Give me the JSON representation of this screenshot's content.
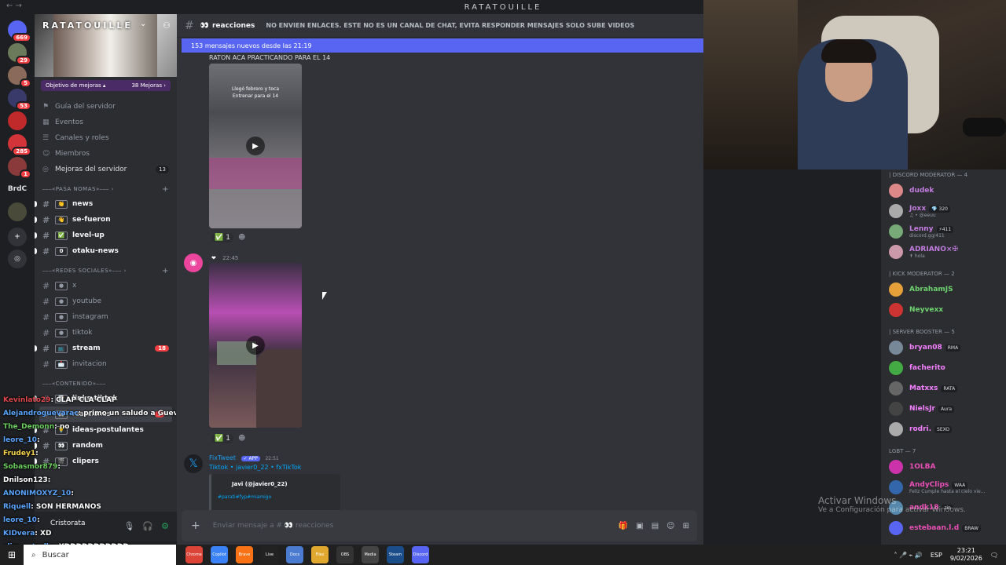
{
  "window": {
    "title": "RATATOUILLE",
    "nav": "← →"
  },
  "rail": {
    "items": [
      {
        "name": "discord-home-icon",
        "badge": "669",
        "color": "#5865f2",
        "label": ""
      },
      {
        "name": "server-1",
        "badge": "29",
        "color": "#6b7a5a",
        "label": ""
      },
      {
        "name": "server-2",
        "badge": "5",
        "color": "#8a6a5a",
        "label": ""
      },
      {
        "name": "server-3",
        "badge": "53",
        "color": "#3a3a6a",
        "label": ""
      },
      {
        "name": "server-4",
        "badge": "",
        "color": "#c02a2a",
        "label": ""
      },
      {
        "name": "server-5",
        "badge": "285",
        "color": "#d3343a",
        "label": ""
      },
      {
        "name": "server-6",
        "badge": "1",
        "color": "#8a3a3a",
        "label": ""
      },
      {
        "name": "server-brdc",
        "badge": "",
        "color": "transparent",
        "label": "BrdC"
      },
      {
        "name": "server-7",
        "badge": "",
        "color": "#4a4a3a",
        "label": ""
      }
    ]
  },
  "sidebar": {
    "server_name": "RATATOUILLE",
    "chevron": "⌄",
    "boost_goal": "Objetivo de mejoras ▴",
    "boost_count": "38 Mejoras ›",
    "menu": [
      {
        "label": "Guía del servidor",
        "icon": "⚑"
      },
      {
        "label": "Eventos",
        "icon": "▦"
      },
      {
        "label": "Canales y roles",
        "icon": "☰"
      },
      {
        "label": "Miembros",
        "icon": "☺"
      },
      {
        "label": "Mejoras del servidor",
        "icon": "◎",
        "count": "13"
      }
    ],
    "cat1": "⎯⎯⎯«PASA NOMAS»⎯⎯⎯ ›",
    "cat1_channels": [
      {
        "emoji": "👏",
        "name": "news",
        "unread": true
      },
      {
        "emoji": "👋",
        "name": "se-fueron",
        "unread": true
      },
      {
        "emoji": "✅",
        "name": "level-up",
        "unread": true
      },
      {
        "emoji": "0",
        "name": "otaku-news",
        "unread": true
      }
    ],
    "cat2": "⎯⎯⎯«REDES SOCIALES»⎯⎯⎯ ›",
    "cat2_channels": [
      {
        "emoji": "●",
        "name": "x",
        "unread": false
      },
      {
        "emoji": "●",
        "name": "youtube",
        "unread": false
      },
      {
        "emoji": "●",
        "name": "instagram",
        "unread": false
      },
      {
        "emoji": "●",
        "name": "tiktok",
        "unread": false
      },
      {
        "emoji": "📺",
        "name": "stream",
        "unread": true,
        "badge": "18"
      },
      {
        "emoji": "📩",
        "name": "invitacion",
        "unread": false
      }
    ],
    "cat3": "⎯⎯⎯«CONTENIDO»⎯⎯⎯",
    "cat3_channels": [
      {
        "emoji": "📑",
        "name": "links-tiktok",
        "unread": true
      },
      {
        "emoji": "👀",
        "name": "reacciones",
        "selected": true,
        "badge": "1"
      },
      {
        "emoji": "💡",
        "name": "ideas-postulantes",
        "unread": true
      },
      {
        "emoji": "👀",
        "name": "random",
        "unread": true
      },
      {
        "emoji": "🎬",
        "name": "clipers",
        "unread": true
      }
    ]
  },
  "channel": {
    "name": "reacciones",
    "emoji": "👀",
    "topic": "NO ENVIEN ENLACES. ESTE NO ES UN CANAL DE CHAT, EVITA RESPONDER MENSAJES SOLO SUBE VIDEOS",
    "new_messages": "153 mensajes nuevos desde las 21:19"
  },
  "messages": {
    "m1_text": "RATON ACA PRACTICANDO PARA EL 14",
    "m1_caption1": "Llegó febrero y toca",
    "m1_caption2": "Entrenar para el 14",
    "m1_react_count": "1",
    "m2_author": "❤",
    "m2_time": "22:45",
    "m2_react_count": "1",
    "m3_author": "FixTweet",
    "m3_badge": "✓ APP",
    "m3_time": "22:51",
    "m3_line": "Tiktok • javier0_22 • fxTikTok",
    "m3_embed_author": "Javi (@javier0_22)",
    "m3_embed_tags": "#parati#fyp#miamigo"
  },
  "composer": {
    "placeholder": "Enviar mensaje a # 👀 reacciones"
  },
  "members": {
    "cat_discord_mod": "| DISCORD MODERATOR — 4",
    "discord_mods": [
      {
        "name": "dudek",
        "color": "#c27cdf",
        "av": "#d88",
        "sub": "",
        "tag": ""
      },
      {
        "name": "Joxx",
        "color": "#c27cdf",
        "av": "#aaa",
        "sub": "♫ • @eeuu",
        "tag": "💎 320"
      },
      {
        "name": "Lenny",
        "color": "#c27cdf",
        "av": "#7a7",
        "sub": "discord.gg/411",
        "tag": "⚡411"
      },
      {
        "name": "ADRIANO×✠",
        "color": "#c27cdf",
        "av": "#c9a",
        "sub": "✝ hola",
        "tag": ""
      }
    ],
    "cat_kick_mod": "| KICK MODERATOR — 2",
    "kick_mods": [
      {
        "name": "AbrahamJS",
        "color": "#6fd36f",
        "av": "#e5a03a",
        "sub": "",
        "tag": ""
      },
      {
        "name": "Neyvexx",
        "color": "#6fd36f",
        "av": "#c33",
        "sub": "",
        "tag": ""
      }
    ],
    "cat_booster": "| SERVER BOOSTER — 5",
    "boosters": [
      {
        "name": "bryan08",
        "color": "#f47fff",
        "av": "#789",
        "sub": "",
        "tag": "RMA"
      },
      {
        "name": "facherito",
        "color": "#f47fff",
        "av": "#4a4",
        "sub": "",
        "tag": ""
      },
      {
        "name": "Matxxs",
        "color": "#f47fff",
        "av": "#666",
        "sub": "",
        "tag": "RATA"
      },
      {
        "name": "NielsJr",
        "color": "#f47fff",
        "av": "#444",
        "sub": "",
        "tag": "Aura"
      },
      {
        "name": "rodri.",
        "color": "#f47fff",
        "av": "#aaa",
        "sub": "",
        "tag": "SEXO"
      }
    ],
    "cat_lgbt": "LGBT — 7",
    "lgbt": [
      {
        "name": "1OLBA",
        "color": "#e94fb4",
        "av": "#c3a",
        "sub": "",
        "tag": ""
      },
      {
        "name": "AndyClips",
        "color": "#e94fb4",
        "av": "#36a",
        "sub": "Feliz Cumple hasta el cielo vie...",
        "tag": "WAA"
      },
      {
        "name": "andk18",
        "color": "#e94fb4",
        "av": "#58a",
        "sub": "",
        "tag": "zio"
      },
      {
        "name": "estebaan.l.d",
        "color": "#e94fb4",
        "av": "#5865f2",
        "sub": "",
        "tag": "BRAW"
      }
    ]
  },
  "stream_chat": [
    {
      "user": "Kevinlato29",
      "color": "#e0484f",
      "msg": ": CLAP CLA CLAP"
    },
    {
      "user": "Alejandroguevarac",
      "color": "#5aa5ff",
      "msg": ": primo un saludo a Guevara"
    },
    {
      "user": "The_Demonn",
      "color": "#6bd05f",
      "msg": ": no"
    },
    {
      "user": "leore_10",
      "color": "#5aa5ff",
      "msg": ":"
    },
    {
      "user": "Frudey1",
      "color": "#f7d44a",
      "msg": ":"
    },
    {
      "user": "Sobasmor879",
      "color": "#6bd05f",
      "msg": ":"
    },
    {
      "user": "Dnilson123",
      "color": "#ffffff",
      "msg": ":"
    },
    {
      "user": "ANONIMOXYZ_10",
      "color": "#5aa5ff",
      "msg": ":"
    },
    {
      "user": "Riquell",
      "color": "#5aa5ff",
      "msg": ": SON HERMANOS"
    },
    {
      "user": "leore_10",
      "color": "#5aa5ff",
      "msg": ":"
    },
    {
      "user": "KIDvera",
      "color": "#5aa5ff",
      "msg": ": XD"
    },
    {
      "user": "slim_estrella",
      "color": "#5aa5ff",
      "msg": ": XDDDDDDDDDDD"
    }
  ],
  "user_panel": {
    "name": "Cristorata"
  },
  "activation": {
    "line1": "Activar Windows",
    "line2": "Ve a Configuración para activar Windows."
  },
  "taskbar": {
    "search": "Buscar",
    "apps": [
      "Chrome",
      "Copilot",
      "Brave",
      "Live",
      "Docs",
      "Files",
      "OBS",
      "Media",
      "Steam",
      "Discord"
    ],
    "lang": "ESP",
    "time": "23:21",
    "date": "9/02/2026"
  }
}
